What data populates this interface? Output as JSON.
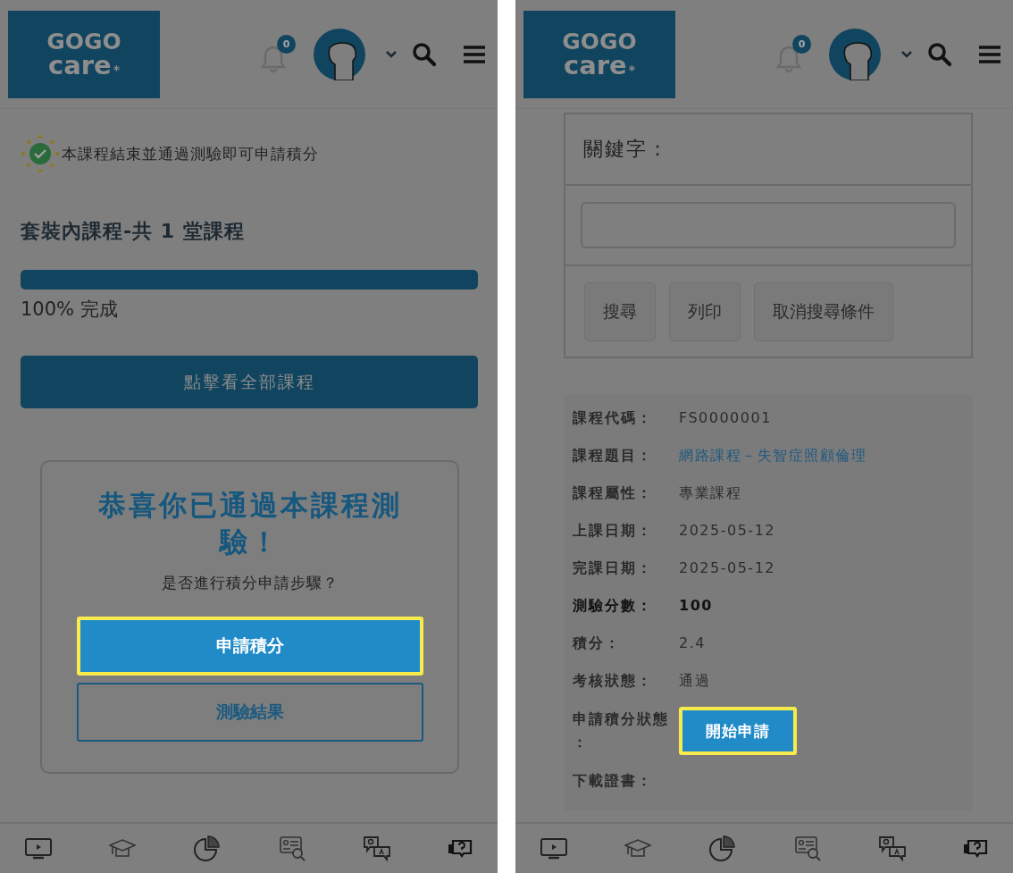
{
  "screens": [
    {
      "kind": "package",
      "header": {
        "logo": {
          "line1": "GOGO",
          "line2": "care",
          "mark": "*"
        },
        "notification_count": "0"
      },
      "notice": "本課程結束並通過測驗即可申請積分",
      "heading": "套裝內課程-共 1 堂課程",
      "progress": {
        "level": 1,
        "reading": "100% 完成"
      },
      "view_all_button": "點擊看全部課程",
      "dialog": {
        "title": "恭喜你已通過本課程測驗！",
        "question": "是否進行積分申請步驟？",
        "buttons": [
          {
            "label": "申請積分",
            "kind": "primary",
            "highlighted": true
          },
          {
            "label": "測驗結果",
            "kind": "outline",
            "highlighted": false
          }
        ]
      }
    },
    {
      "kind": "record",
      "header": {
        "logo": {
          "line1": "GOGO",
          "line2": "care",
          "mark": "*"
        },
        "notification_count": "0"
      },
      "search_form": {
        "label": "關鍵字：",
        "buttons": [
          "搜尋",
          "列印",
          "取消搜尋條件"
        ]
      },
      "details": [
        {
          "label": "課程代碼：",
          "kind": "text",
          "value": "FS0000001",
          "emphasis": false
        },
        {
          "label": "課程題目：",
          "kind": "link",
          "value": "網路課程－失智症照顧倫理",
          "emphasis": false
        },
        {
          "label": "課程屬性：",
          "kind": "text",
          "value": "專業課程",
          "emphasis": false
        },
        {
          "label": "上課日期：",
          "kind": "text",
          "value": "2025-05-12",
          "emphasis": false
        },
        {
          "label": "完課日期：",
          "kind": "text",
          "value": "2025-05-12",
          "emphasis": false
        },
        {
          "label": "測驗分數：",
          "kind": "text",
          "value": "100",
          "emphasis": true
        },
        {
          "label": "積分：",
          "kind": "text",
          "value": "2.4",
          "emphasis": false
        },
        {
          "label": "考核狀態：",
          "kind": "text",
          "value": "通過",
          "emphasis": false
        },
        {
          "label": "申請積分狀態：",
          "kind": "button",
          "value": "開始申請",
          "highlighted": true,
          "emphasis": false
        },
        {
          "label": "下載證書：",
          "kind": "empty",
          "emphasis": false
        }
      ]
    }
  ]
}
